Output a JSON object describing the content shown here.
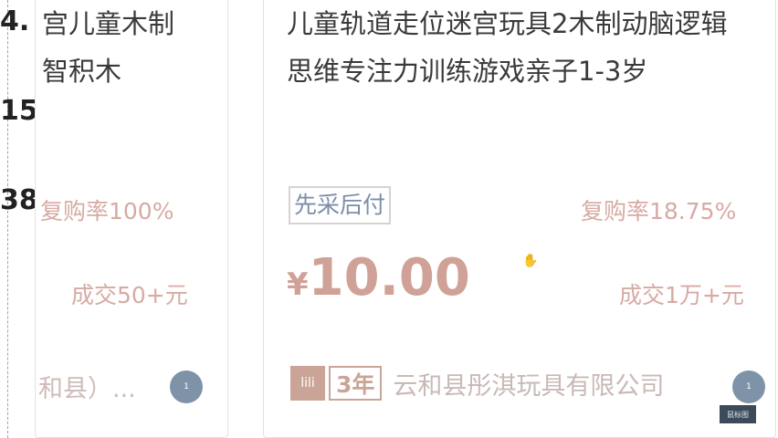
{
  "side_numbers": [
    "4.",
    "15",
    "38"
  ],
  "left_card": {
    "title_line1": "宫儿童木制",
    "title_line2": "智积木",
    "repurchase": "复购率100%",
    "deal": "成交50+元",
    "shop_partial": "和县）...",
    "circle_label": "1"
  },
  "right_card": {
    "title_line1": "儿童轨道走位迷宫玩具2木制动脑逻辑",
    "title_line2": "思维专注力训练游戏亲子1-3岁",
    "badge": "先采后付",
    "repurchase": "复购率18.75%",
    "price_currency": "¥",
    "price_value": "10.00",
    "deal": "成交1万+元",
    "shop_icon_label": "lili",
    "shop_years": "3年",
    "shop_name": "云和县彤淇玩具有限公司",
    "circle_label": "1"
  },
  "corner_tag": "鼠标图",
  "colors": {
    "accent_price": "#d0a196",
    "muted_pink": "#d7aaa3",
    "badge_blue": "#7c8ea9",
    "circle_blue": "#7e93a8"
  },
  "icons": {
    "cursor": "hand-cursor-icon",
    "shop": "shop-icon"
  }
}
